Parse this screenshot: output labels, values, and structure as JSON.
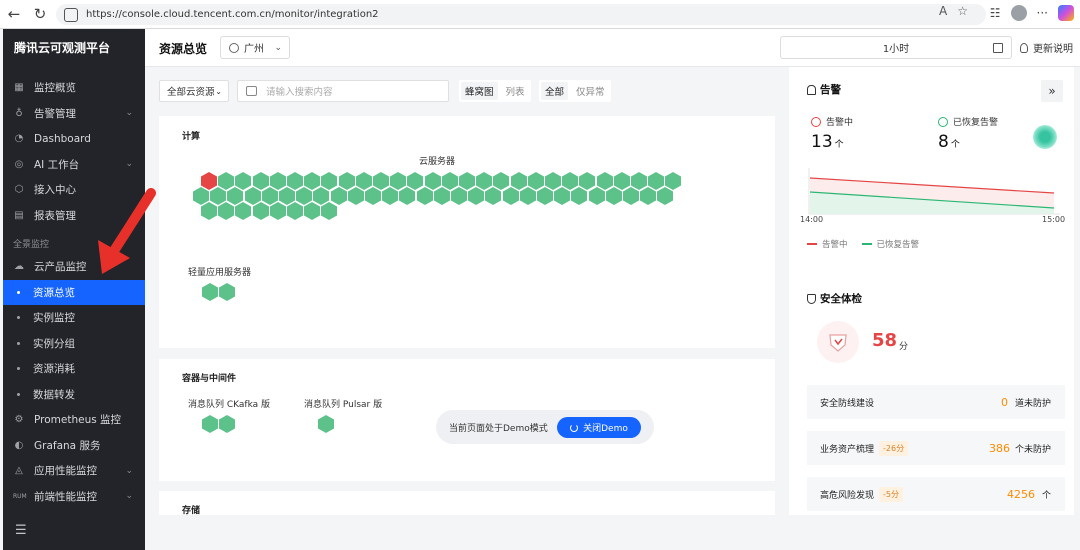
{
  "browser": {
    "url": "https://console.cloud.tencent.com.cn/monitor/integration2"
  },
  "sidebar": {
    "brand": "腾讯云可观测平台",
    "items": [
      {
        "label": "监控概览",
        "icon": "grid-icon"
      },
      {
        "label": "告警管理",
        "icon": "alarm-icon",
        "expandable": true
      },
      {
        "label": "Dashboard",
        "icon": "dashboard-icon"
      },
      {
        "label": "AI 工作台",
        "icon": "ai-icon",
        "expandable": true
      },
      {
        "label": "接入中心",
        "icon": "cube-icon"
      },
      {
        "label": "报表管理",
        "icon": "report-icon"
      }
    ],
    "group_label": "全景监控",
    "cloud_item": {
      "label": "云产品监控",
      "icon": "cloud-icon"
    },
    "sub_items": [
      {
        "label": "资源总览",
        "active": true
      },
      {
        "label": "实例监控"
      },
      {
        "label": "实例分组"
      },
      {
        "label": "资源消耗"
      },
      {
        "label": "数据转发"
      }
    ],
    "bottom_items": [
      {
        "label": "Prometheus 监控",
        "icon": "prometheus-icon"
      },
      {
        "label": "Grafana 服务",
        "icon": "grafana-icon"
      },
      {
        "label": "应用性能监控",
        "icon": "apm-icon",
        "expandable": true
      },
      {
        "label": "前端性能监控",
        "tag": "RUM",
        "expandable": true
      }
    ]
  },
  "topbar": {
    "title": "资源总览",
    "region": "广州",
    "time_range": "1小时",
    "help": "更新说明"
  },
  "filters": {
    "resource_select": "全部云资源",
    "search_placeholder": "请输入搜索内容",
    "view_modes": [
      "蜂窝图",
      "列表"
    ],
    "active_view": "蜂窝图",
    "status_modes": [
      "全部",
      "仅异常"
    ],
    "active_status": "全部"
  },
  "compute_card": {
    "title": "计算",
    "cvm_label": "云服务器",
    "cvm_rows": [
      28,
      28,
      8
    ],
    "cvm_alert_count": 1,
    "lighthouse_label": "轻量应用服务器",
    "lighthouse_count": 2
  },
  "middleware_card": {
    "title": "容器与中间件",
    "ckafka_label": "消息队列 CKafka 版",
    "ckafka_count": 2,
    "pulsar_label": "消息队列 Pulsar 版",
    "pulsar_count": 1
  },
  "storage_card": {
    "title": "存储"
  },
  "demo": {
    "text": "当前页面处于Demo模式",
    "button": "关闭Demo"
  },
  "alarm_panel": {
    "title": "告警",
    "firing_label": "告警中",
    "firing_count": "13",
    "firing_unit": "个",
    "recovered_label": "已恢复告警",
    "recovered_count": "8",
    "recovered_unit": "个",
    "x_start": "14:00",
    "x_end": "15:00",
    "legend_firing": "告警中",
    "legend_recovered": "已恢复告警",
    "colors": {
      "firing": "#e54545",
      "recovered": "#2bb673"
    }
  },
  "security_panel": {
    "title": "安全体检",
    "score": "58",
    "score_unit": "分",
    "rows": [
      {
        "label": "安全防线建设",
        "tag": "",
        "value": "0",
        "unit": "道未防护"
      },
      {
        "label": "业务资产梳理",
        "tag": "-26分",
        "value": "386",
        "unit": "个未防护"
      },
      {
        "label": "高危风险发现",
        "tag": "-5分",
        "value": "4256",
        "unit": "个"
      }
    ]
  },
  "colors": {
    "accent": "#1664ff",
    "healthy_hex": "#5cc28a",
    "alert_hex": "#e54545",
    "sidebar_bg": "#232429"
  }
}
